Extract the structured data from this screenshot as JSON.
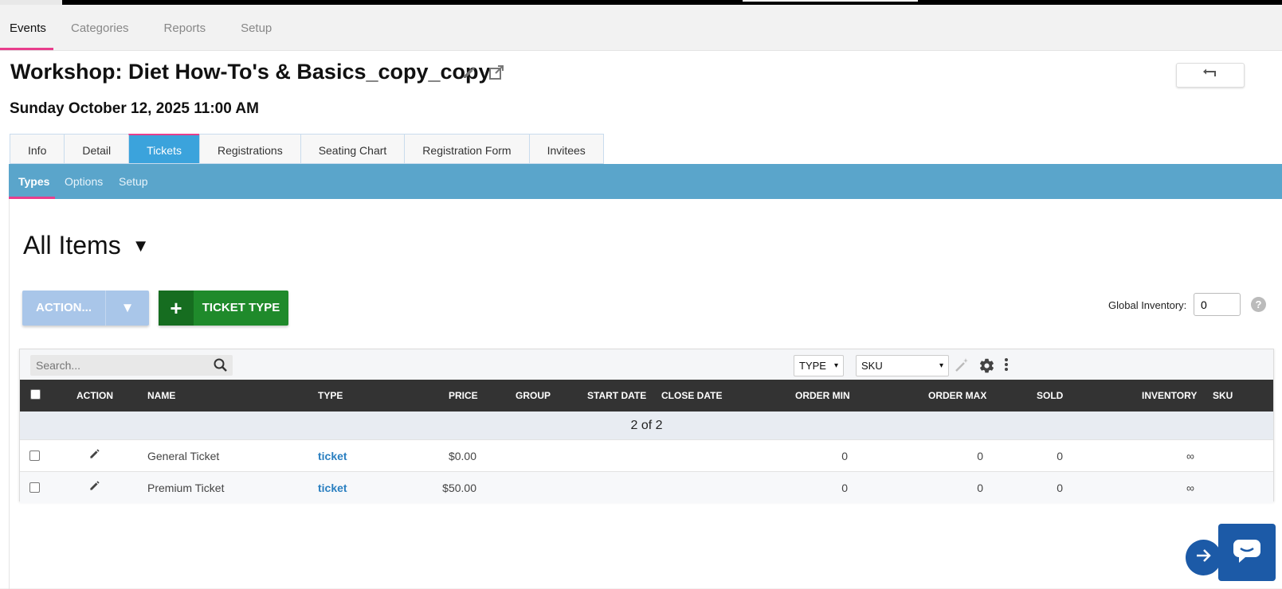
{
  "main_nav": [
    "Events",
    "Categories",
    "Reports",
    "Setup"
  ],
  "event": {
    "title": "Workshop: Diet How-To's & Basics_copy_copy",
    "datetime": "Sunday October 12, 2025 11:00 AM"
  },
  "tabs": [
    "Info",
    "Detail",
    "Tickets",
    "Registrations",
    "Seating Chart",
    "Registration Form",
    "Invitees"
  ],
  "active_tab": "Tickets",
  "subtabs": [
    "Types",
    "Options",
    "Setup"
  ],
  "active_subtab": "Types",
  "view_title": "All Items",
  "buttons": {
    "action": "ACTION...",
    "add_ticket_type": "TICKET TYPE"
  },
  "global_inventory": {
    "label": "Global Inventory:",
    "value": "0"
  },
  "grid": {
    "search_placeholder": "Search...",
    "filter_type": "TYPE",
    "filter_sku": "SKU",
    "headers": {
      "action": "ACTION",
      "name": "NAME",
      "type": "TYPE",
      "price": "PRICE",
      "group": "GROUP",
      "start_date": "START DATE",
      "close_date": "CLOSE DATE",
      "order_min": "ORDER MIN",
      "order_max": "ORDER MAX",
      "sold": "SOLD",
      "inventory": "INVENTORY",
      "sku": "SKU"
    },
    "record_count": "2 of 2",
    "rows": [
      {
        "name": "General Ticket",
        "type": "ticket",
        "price": "$0.00",
        "group": "",
        "start_date": "",
        "close_date": "",
        "order_min": "0",
        "order_max": "0",
        "sold": "0",
        "inventory": "∞",
        "sku": ""
      },
      {
        "name": "Premium Ticket",
        "type": "ticket",
        "price": "$50.00",
        "group": "",
        "start_date": "",
        "close_date": "",
        "order_min": "0",
        "order_max": "0",
        "sold": "0",
        "inventory": "∞",
        "sku": ""
      }
    ]
  },
  "colors": {
    "accent_pink": "#e83e8c",
    "tab_active_blue": "#3ba3dc",
    "subbar_blue": "#5aa5cb",
    "action_button": "#a9c6e9",
    "ticket_button_green": "#1f8a2b",
    "link_blue": "#2a7fc0",
    "chat_blue": "#1c5aa7"
  },
  "icons": {
    "edit": "pencil-icon",
    "open_external": "external-link-icon",
    "back": "return-arrow-icon",
    "search": "search-icon",
    "magic": "magic-wand-icon",
    "settings": "gear-icon",
    "more": "kebab-menu-icon",
    "next": "arrow-right-icon",
    "chat": "chat-bubble-icon"
  }
}
